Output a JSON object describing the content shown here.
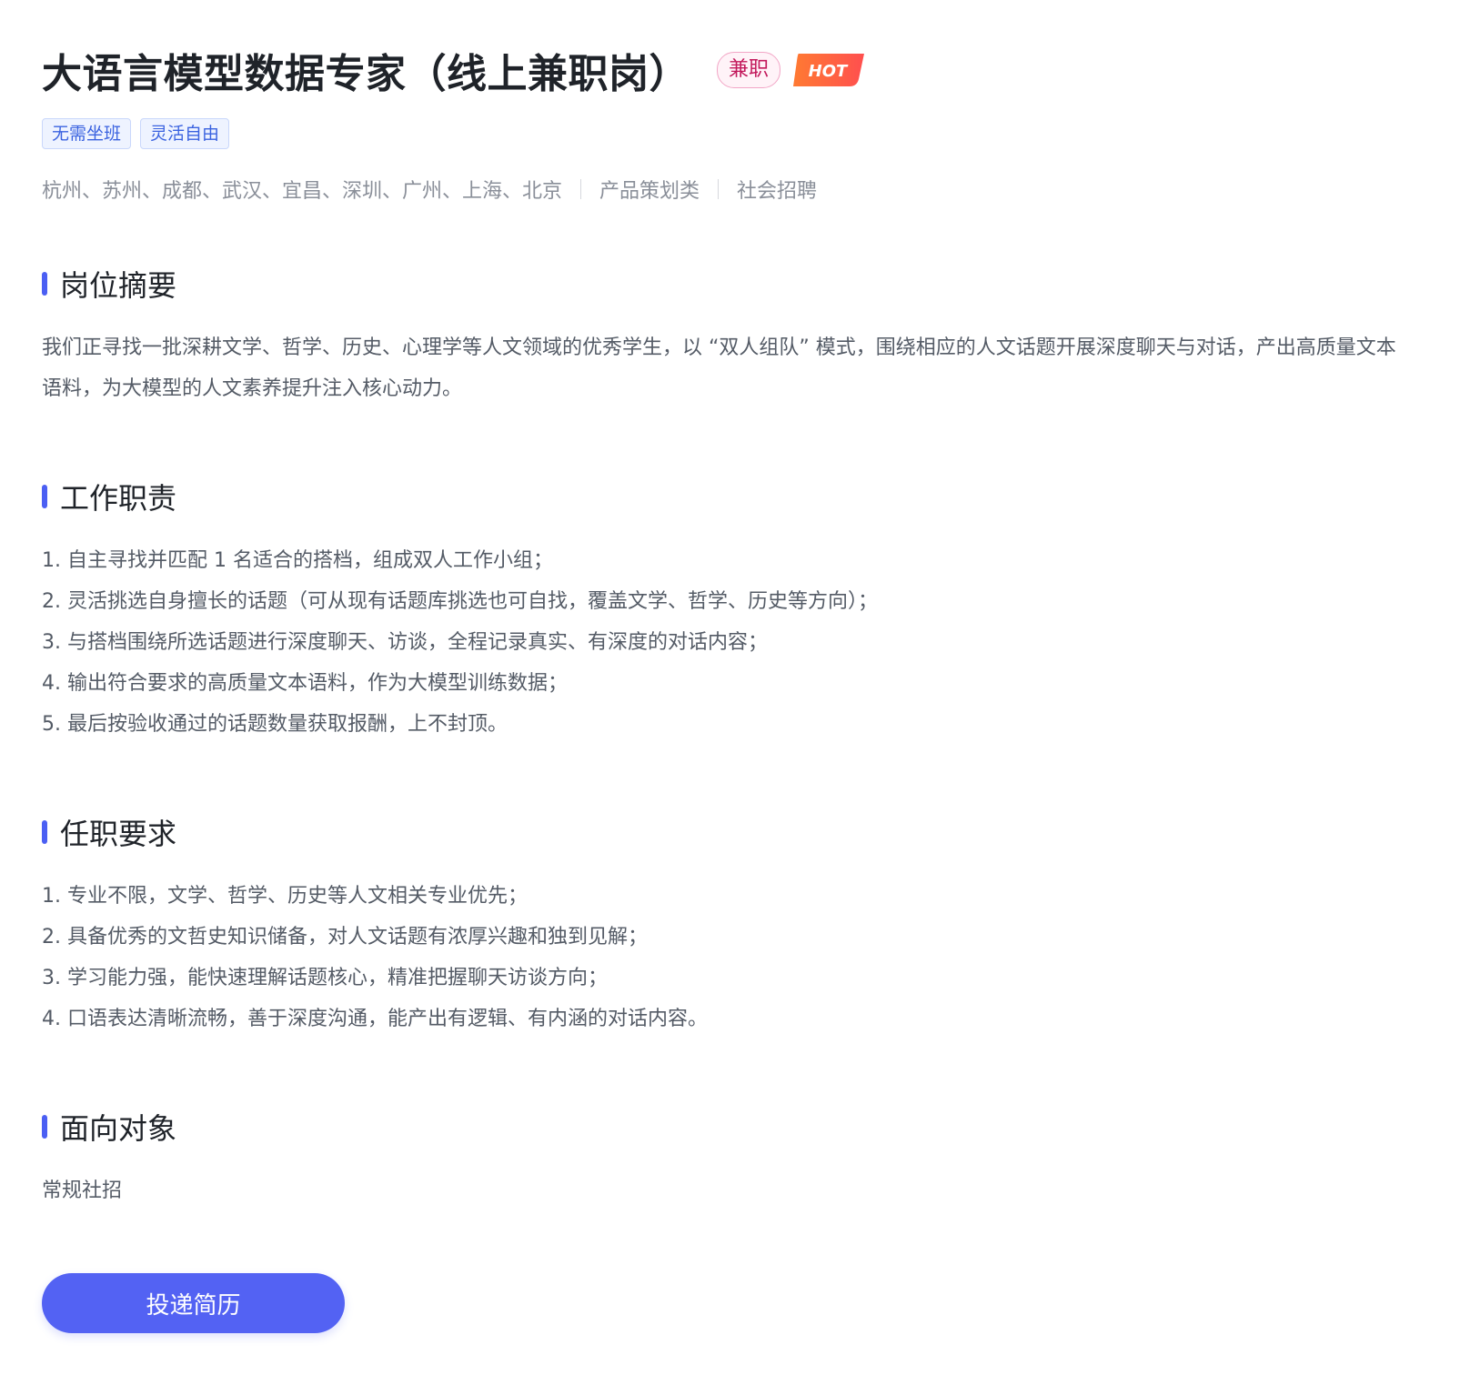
{
  "job": {
    "title": "大语言模型数据专家（线上兼职岗）",
    "type_badge": "兼职",
    "hot_badge": "HOT",
    "tags": [
      "无需坐班",
      "灵活自由"
    ],
    "locations": "杭州、苏州、成都、武汉、宜昌、深圳、广州、上海、北京",
    "category": "产品策划类",
    "recruit_type": "社会招聘"
  },
  "sections": {
    "summary": {
      "title": "岗位摘要",
      "text": "我们正寻找一批深耕文学、哲学、历史、心理学等人文领域的优秀学生，以 “双人组队” 模式，围绕相应的人文话题开展深度聊天与对话，产出高质量文本语料，为大模型的人文素养提升注入核心动力。"
    },
    "duties": {
      "title": "工作职责",
      "items": [
        "1. 自主寻找并匹配 1 名适合的搭档，组成双人工作小组；",
        "2. 灵活挑选自身擅长的话题（可从现有话题库挑选也可自找，覆盖文学、哲学、历史等方向）；",
        "3. 与搭档围绕所选话题进行深度聊天、访谈，全程记录真实、有深度的对话内容；",
        "4. 输出符合要求的高质量文本语料，作为大模型训练数据；",
        "5. 最后按验收通过的话题数量获取报酬，上不封顶。"
      ]
    },
    "requirements": {
      "title": "任职要求",
      "items": [
        "1. 专业不限，文学、哲学、历史等人文相关专业优先；",
        "2. 具备优秀的文哲史知识储备，对人文话题有浓厚兴趣和独到见解；",
        "3. 学习能力强，能快速理解话题核心，精准把握聊天访谈方向；",
        "4. 口语表达清晰流畅，善于深度沟通，能产出有逻辑、有内涵的对话内容。"
      ]
    },
    "audience": {
      "title": "面向对象",
      "text": "常规社招"
    }
  },
  "actions": {
    "apply_label": "投递简历"
  },
  "colors": {
    "accent": "#5362f3",
    "section_bar": "#4b5ff3",
    "tag_text": "#3b63e0",
    "badge_pink": "#c2185b",
    "hot_orange": "#ff6a3d"
  }
}
